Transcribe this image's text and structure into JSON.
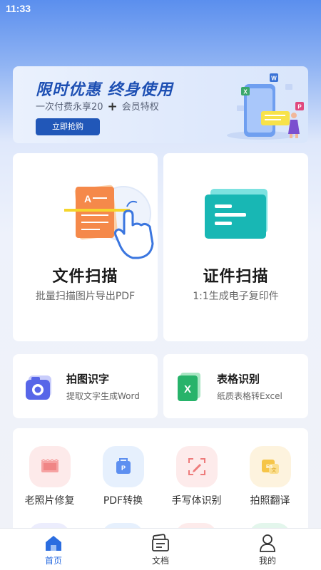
{
  "status_bar": {
    "time": "11:33"
  },
  "banner": {
    "title": "限时优惠 终身使用",
    "subtitle_left": "一次付费永享20",
    "subtitle_plus": "+",
    "subtitle_right": "会员特权",
    "button": "立即抢购"
  },
  "features": [
    {
      "title": "文件扫描",
      "subtitle": "批量扫描图片导出PDF",
      "icon": "document-scan-icon"
    },
    {
      "title": "证件扫描",
      "subtitle": "1:1生成电子复印件",
      "icon": "id-card-icon"
    }
  ],
  "quick": [
    {
      "title": "拍图识字",
      "subtitle": "提取文字生成Word",
      "icon": "camera-icon"
    },
    {
      "title": "表格识别",
      "subtitle": "纸质表格转Excel",
      "icon": "excel-icon"
    }
  ],
  "tools": [
    {
      "label": "老照片修复",
      "icon": "photo-restore-icon",
      "bg": "#fdeaea"
    },
    {
      "label": "PDF转换",
      "icon": "pdf-convert-icon",
      "bg": "#e6f0fd"
    },
    {
      "label": "手写体识别",
      "icon": "handwriting-icon",
      "bg": "#fdebeb"
    },
    {
      "label": "拍照翻译",
      "icon": "translate-icon",
      "bg": "#fdf3de"
    }
  ],
  "tabs": [
    {
      "label": "首页",
      "icon": "home-icon",
      "active": true
    },
    {
      "label": "文档",
      "icon": "documents-icon",
      "active": false
    },
    {
      "label": "我的",
      "icon": "profile-icon",
      "active": false
    }
  ],
  "colors": {
    "accent": "#2b6de0",
    "banner_button": "#2157b8",
    "banner_title": "#1d4fb3"
  }
}
